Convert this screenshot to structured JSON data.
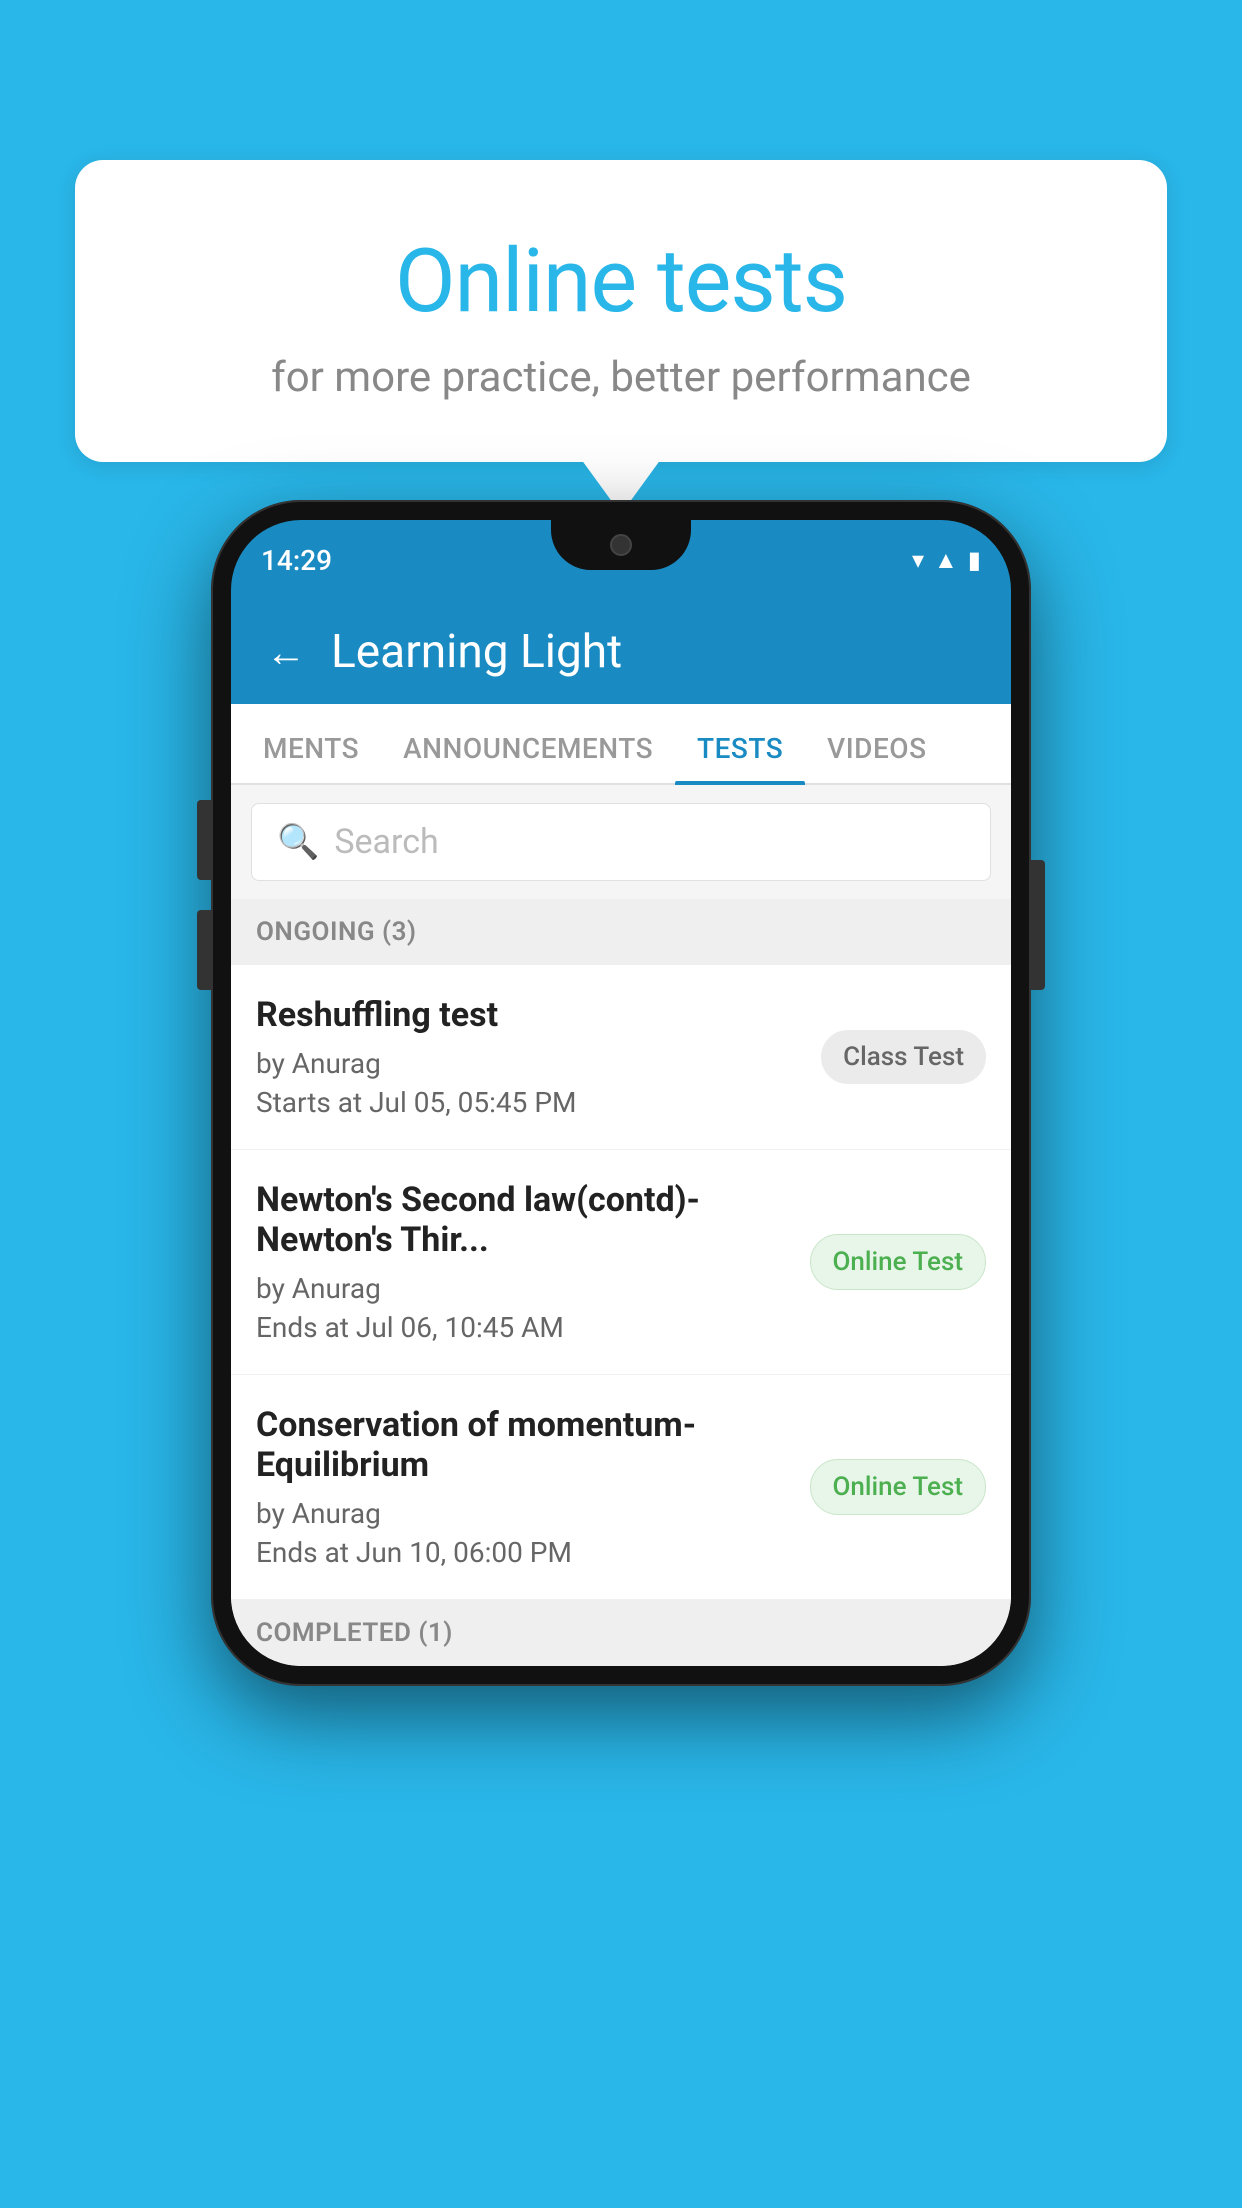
{
  "background": {
    "color": "#29b6e8"
  },
  "speech_bubble": {
    "title": "Online tests",
    "subtitle": "for more practice, better performance"
  },
  "phone": {
    "status_bar": {
      "time": "14:29",
      "icons": [
        "wifi",
        "signal",
        "battery"
      ]
    },
    "app_header": {
      "back_label": "←",
      "title": "Learning Light"
    },
    "tabs": [
      {
        "label": "MENTS",
        "active": false
      },
      {
        "label": "ANNOUNCEMENTS",
        "active": false
      },
      {
        "label": "TESTS",
        "active": true
      },
      {
        "label": "VIDEOS",
        "active": false
      }
    ],
    "search": {
      "placeholder": "Search"
    },
    "sections": [
      {
        "header": "ONGOING (3)",
        "items": [
          {
            "name": "Reshuffling test",
            "author": "by Anurag",
            "date": "Starts at  Jul 05, 05:45 PM",
            "badge": "Class Test",
            "badge_type": "class"
          },
          {
            "name": "Newton's Second law(contd)-Newton's Thir...",
            "author": "by Anurag",
            "date": "Ends at  Jul 06, 10:45 AM",
            "badge": "Online Test",
            "badge_type": "online"
          },
          {
            "name": "Conservation of momentum-Equilibrium",
            "author": "by Anurag",
            "date": "Ends at  Jun 10, 06:00 PM",
            "badge": "Online Test",
            "badge_type": "online"
          }
        ]
      },
      {
        "header": "COMPLETED (1)",
        "items": []
      }
    ]
  }
}
